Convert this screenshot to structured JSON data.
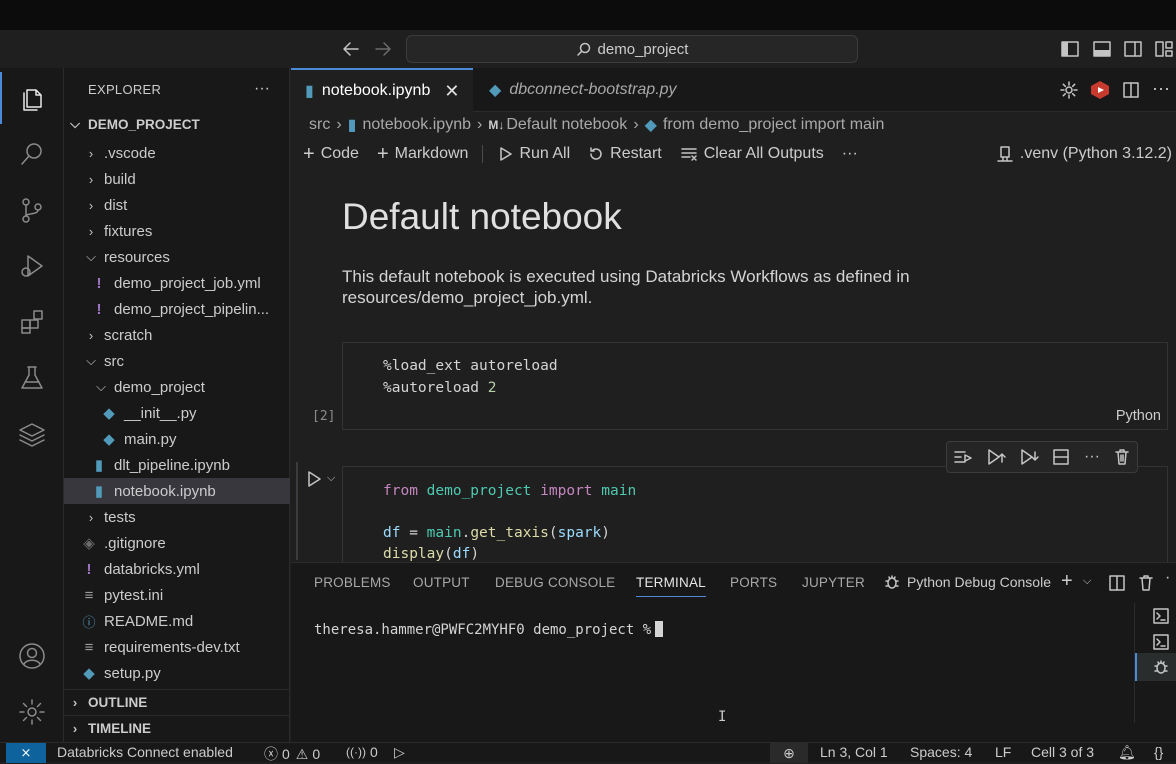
{
  "command_center": {
    "text": "demo_project"
  },
  "sidebar": {
    "title": "EXPLORER",
    "root": "DEMO_PROJECT",
    "items": [
      {
        "label": ".vscode"
      },
      {
        "label": "build"
      },
      {
        "label": "dist"
      },
      {
        "label": "fixtures"
      },
      {
        "label": "resources"
      },
      {
        "label": "demo_project_job.yml"
      },
      {
        "label": "demo_project_pipelin..."
      },
      {
        "label": "scratch"
      },
      {
        "label": "src"
      },
      {
        "label": "demo_project"
      },
      {
        "label": "__init__.py"
      },
      {
        "label": "main.py"
      },
      {
        "label": "dlt_pipeline.ipynb"
      },
      {
        "label": "notebook.ipynb"
      },
      {
        "label": "tests"
      },
      {
        "label": ".gitignore"
      },
      {
        "label": "databricks.yml"
      },
      {
        "label": "pytest.ini"
      },
      {
        "label": "README.md"
      },
      {
        "label": "requirements-dev.txt"
      },
      {
        "label": "setup.py"
      }
    ],
    "outline": "OUTLINE",
    "timeline": "TIMELINE"
  },
  "tabs": [
    {
      "label": "notebook.ipynb"
    },
    {
      "label": "dbconnect-bootstrap.py"
    }
  ],
  "breadcrumb": {
    "a": "src",
    "b": "notebook.ipynb",
    "c": "Default notebook",
    "c_prefix": "M↓",
    "d": "from demo_project import main"
  },
  "toolbar": {
    "code": "Code",
    "markdown": "Markdown",
    "run_all": "Run All",
    "restart": "Restart",
    "clear": "Clear All Outputs",
    "kernel": ".venv (Python 3.12.2)"
  },
  "notebook": {
    "title": "Default notebook",
    "desc": "This default notebook is executed using Databricks Workflows as defined in resources/demo_project_job.yml.",
    "cell1": {
      "line1": "%load_ext autoreload",
      "line2_a": "%autoreload",
      "line2_b": "2",
      "count": "[2]",
      "lang": "Python"
    },
    "cell2": {
      "from": "from",
      "module": "demo_project",
      "import": "import",
      "name": "main",
      "df": "df",
      "eq": " = ",
      "main": "main",
      "dot": ".",
      "get_taxis": "get_taxis",
      "spark": "spark",
      "display": "display",
      "df2": "df"
    }
  },
  "panel": {
    "tabs": [
      "PROBLEMS",
      "OUTPUT",
      "DEBUG CONSOLE",
      "TERMINAL",
      "PORTS",
      "JUPYTER"
    ],
    "debug_console": "Python Debug Console",
    "prompt": "theresa.hammer@PWFC2MYHF0 demo_project %"
  },
  "status": {
    "connect": "Databricks Connect enabled",
    "errors": "0",
    "warnings": "0",
    "ports": "0",
    "position": "Ln 3, Col 1",
    "spaces": "Spaces: 4",
    "eol": "LF",
    "cell": "Cell 3 of 3"
  },
  "colors": {
    "accent": "#4c8ad8",
    "python_icon": "#519aba",
    "notebook_icon": "#519aba",
    "yaml_icon": "#a074c4",
    "remote": "#0e639c"
  }
}
